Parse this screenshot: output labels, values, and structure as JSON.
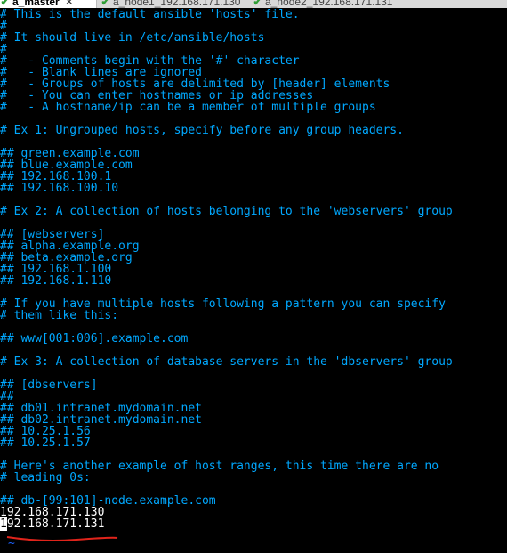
{
  "tabs": [
    {
      "label": "a_master",
      "close": "✕",
      "active": true
    },
    {
      "label": "a_node1_192.168.171.130",
      "active": false
    },
    {
      "label": "a_node2_192.168.171.131",
      "active": false
    }
  ],
  "lines": [
    "# This is the default ansible 'hosts' file.",
    "#",
    "# It should live in /etc/ansible/hosts",
    "#",
    "#   - Comments begin with the '#' character",
    "#   - Blank lines are ignored",
    "#   - Groups of hosts are delimited by [header] elements",
    "#   - You can enter hostnames or ip addresses",
    "#   - A hostname/ip can be a member of multiple groups",
    "",
    "# Ex 1: Ungrouped hosts, specify before any group headers.",
    "",
    "## green.example.com",
    "## blue.example.com",
    "## 192.168.100.1",
    "## 192.168.100.10",
    "",
    "# Ex 2: A collection of hosts belonging to the 'webservers' group",
    "",
    "## [webservers]",
    "## alpha.example.org",
    "## beta.example.org",
    "## 192.168.1.100",
    "## 192.168.1.110",
    "",
    "# If you have multiple hosts following a pattern you can specify",
    "# them like this:",
    "",
    "## www[001:006].example.com",
    "",
    "# Ex 3: A collection of database servers in the 'dbservers' group",
    "",
    "## [dbservers]",
    "##",
    "## db01.intranet.mydomain.net",
    "## db02.intranet.mydomain.net",
    "## 10.25.1.56",
    "## 10.25.1.57",
    "",
    "# Here's another example of host ranges, this time there are no",
    "# leading 0s:",
    "",
    "## db-[99:101]-node.example.com",
    "192.168.171.130"
  ],
  "last_line": {
    "cursor_char": "1",
    "rest": "92.168.171.131"
  },
  "tilde": "~",
  "colors": {
    "comment": "#00a8ff",
    "text": "#ffffff",
    "tilde": "#1c63ff",
    "underline": "#e0241b",
    "tab_icon": "#2e9d35"
  }
}
